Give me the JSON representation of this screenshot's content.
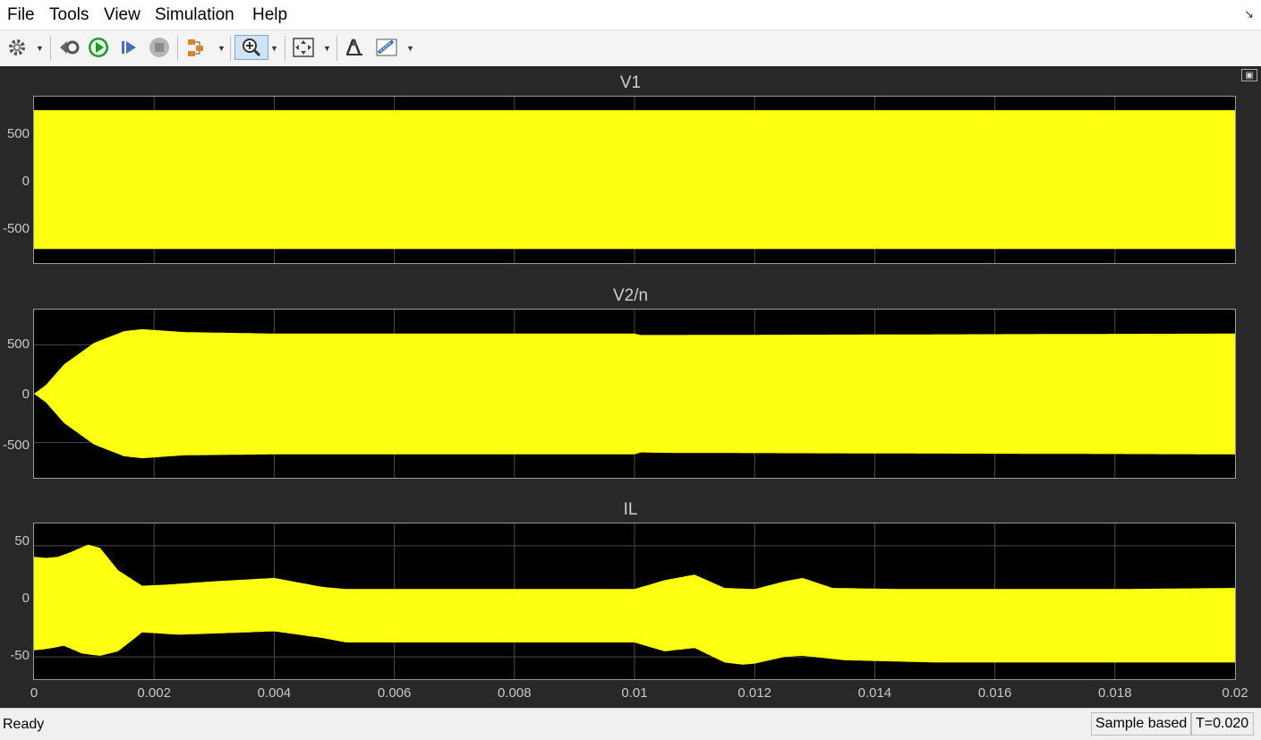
{
  "menu": [
    "File",
    "Tools",
    "View",
    "Simulation",
    "Help"
  ],
  "toolbar": {
    "icons": [
      "gear-icon",
      "step-back-icon",
      "run-icon",
      "step-forward-icon",
      "stop-icon",
      "highlight-model-icon",
      "zoom-in-icon",
      "fit-to-view-icon",
      "write-data-icon",
      "measurements-icon"
    ]
  },
  "colors": {
    "signal": "#ffff12",
    "plot_bg": "#000000",
    "figure_bg": "#282828",
    "grid": "#4a4a4a"
  },
  "chart_data": [
    {
      "type": "line",
      "title": "V1",
      "xlim": [
        0,
        0.02
      ],
      "ylim": [
        -860,
        860
      ],
      "yticks": [
        "500",
        "0",
        "-500"
      ],
      "grid": true,
      "note_style": "dense sinusoid envelope",
      "upper": {
        "x": [
          0,
          0.02
        ],
        "y": [
          720,
          720
        ]
      },
      "lower": {
        "x": [
          0,
          0.02
        ],
        "y": [
          -715,
          -715
        ]
      }
    },
    {
      "type": "line",
      "title": "V2/n",
      "xlim": [
        0,
        0.02
      ],
      "ylim": [
        -860,
        860
      ],
      "yticks": [
        "500",
        "0",
        "-500"
      ],
      "grid": true,
      "upper": {
        "x": [
          0,
          0.0002,
          0.0005,
          0.001,
          0.0015,
          0.0018,
          0.0025,
          0.004,
          0.01,
          0.0101,
          0.0105,
          0.02
        ],
        "y": [
          0,
          90,
          300,
          520,
          640,
          660,
          630,
          615,
          615,
          600,
          600,
          615
        ]
      },
      "lower": {
        "x": [
          0,
          0.0002,
          0.0005,
          0.001,
          0.0015,
          0.0018,
          0.0025,
          0.004,
          0.01,
          0.0101,
          0.0105,
          0.02
        ],
        "y": [
          0,
          -90,
          -300,
          -520,
          -640,
          -660,
          -630,
          -620,
          -620,
          -600,
          -605,
          -620
        ]
      }
    },
    {
      "type": "line",
      "title": "IL",
      "xlim": [
        0,
        0.02
      ],
      "ylim": [
        -70,
        70
      ],
      "yticks": [
        "50",
        "0",
        "-50"
      ],
      "xticks": [
        "0",
        "0.002",
        "0.004",
        "0.006",
        "0.008",
        "0.01",
        "0.012",
        "0.014",
        "0.016",
        "0.018",
        "0.02"
      ],
      "grid": true,
      "upper": {
        "x": [
          0,
          0.0002,
          0.0004,
          0.0006,
          0.0009,
          0.0011,
          0.0014,
          0.0018,
          0.0022,
          0.003,
          0.004,
          0.0048,
          0.0052,
          0.006,
          0.008,
          0.01,
          0.0105,
          0.011,
          0.0115,
          0.012,
          0.0125,
          0.0128,
          0.0133,
          0.0145,
          0.016,
          0.018,
          0.02
        ],
        "y": [
          40,
          39,
          40,
          44,
          51,
          48,
          28,
          14,
          15,
          18,
          21,
          13,
          11,
          11,
          11,
          11,
          19,
          24,
          12,
          11,
          18,
          21,
          12,
          11,
          11,
          11,
          12
        ]
      },
      "lower": {
        "x": [
          0,
          0.0002,
          0.0005,
          0.0008,
          0.0011,
          0.0014,
          0.0018,
          0.0024,
          0.003,
          0.004,
          0.0048,
          0.0052,
          0.006,
          0.008,
          0.01,
          0.0105,
          0.011,
          0.0115,
          0.0118,
          0.012,
          0.0125,
          0.0128,
          0.0135,
          0.015,
          0.017,
          0.02
        ],
        "y": [
          -44,
          -43,
          -40,
          -47,
          -49,
          -45,
          -28,
          -30,
          -29,
          -27,
          -33,
          -37,
          -37,
          -37,
          -37,
          -45,
          -42,
          -55,
          -57,
          -56,
          -50,
          -49,
          -53,
          -55,
          -55,
          -55
        ]
      }
    }
  ],
  "status": {
    "left": "Ready",
    "sample": "Sample based",
    "time": "T=0.020"
  }
}
